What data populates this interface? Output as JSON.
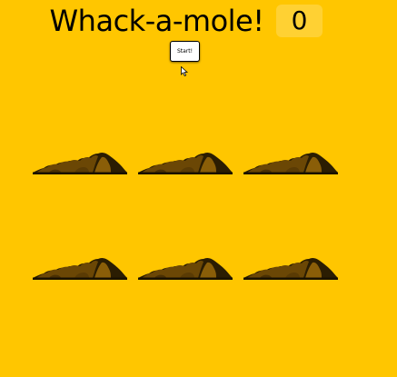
{
  "game": {
    "title": "Whack-a-mole!",
    "score": "0",
    "start_label": "Start!"
  },
  "colors": {
    "background": "#ffc600",
    "dirt_dark": "#2b1d02",
    "dirt_mid": "#6b4705",
    "dirt_light": "#8a5e08"
  },
  "holes": [
    {
      "id": 1,
      "icon": "dirt-mound-icon"
    },
    {
      "id": 2,
      "icon": "dirt-mound-icon"
    },
    {
      "id": 3,
      "icon": "dirt-mound-icon"
    },
    {
      "id": 4,
      "icon": "dirt-mound-icon"
    },
    {
      "id": 5,
      "icon": "dirt-mound-icon"
    },
    {
      "id": 6,
      "icon": "dirt-mound-icon"
    }
  ]
}
